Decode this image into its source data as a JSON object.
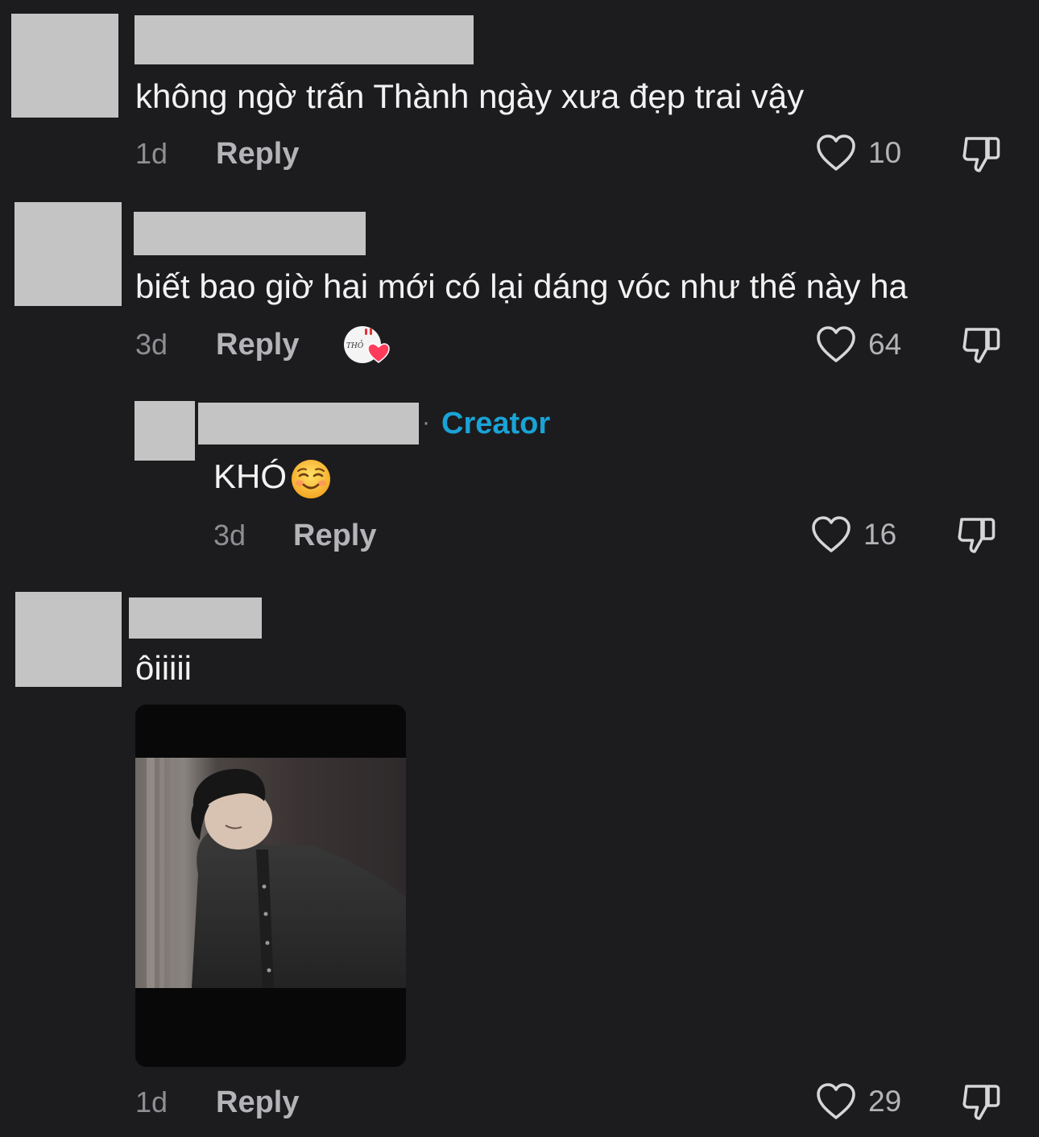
{
  "comments": [
    {
      "text": "không ngờ trấn Thành ngày xưa đẹp trai vậy",
      "time": "1d",
      "reply_label": "Reply",
      "likes": "10"
    },
    {
      "text": "biết bao giờ hai mới có lại dáng vóc như thế này ha",
      "time": "3d",
      "reply_label": "Reply",
      "likes": "64",
      "sticker_icon": "heart-sticker-icon"
    },
    {
      "is_reply": true,
      "separator": "·",
      "badge": "Creator",
      "text": "KHÓ",
      "emoji": "smiling-face-icon",
      "time": "3d",
      "reply_label": "Reply",
      "likes": "16"
    },
    {
      "text": "ôiiiii",
      "time": "1d",
      "reply_label": "Reply",
      "likes": "29",
      "media": "video-thumbnail"
    }
  ],
  "icons": {
    "like": "heart-outline-icon",
    "dislike": "thumbs-down-icon"
  },
  "colors": {
    "background": "#1c1c1e",
    "creator_badge": "#1aa3d6",
    "redaction": "#c4c4c4",
    "text": "#f2f2f2",
    "muted": "#8e8e93"
  }
}
